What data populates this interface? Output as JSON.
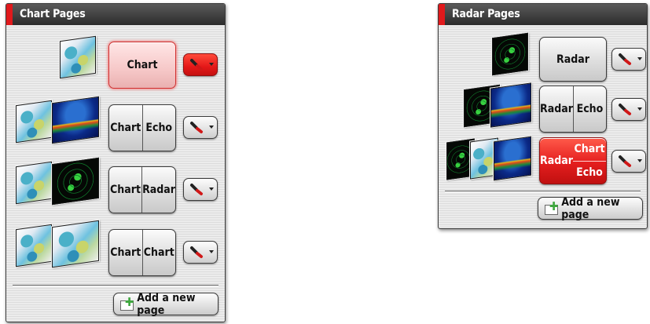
{
  "chart_panel": {
    "title": "Chart Pages",
    "rows": [
      {
        "thumbs": [
          "chart"
        ],
        "segments": [
          "Chart"
        ],
        "state": "selected"
      },
      {
        "thumbs": [
          "chart",
          "echo"
        ],
        "segments": [
          "Chart",
          "Echo"
        ],
        "state": "normal"
      },
      {
        "thumbs": [
          "chart",
          "radar"
        ],
        "segments": [
          "Chart",
          "Radar"
        ],
        "state": "normal"
      },
      {
        "thumbs": [
          "chart",
          "chart"
        ],
        "segments": [
          "Chart",
          "Chart"
        ],
        "state": "normal"
      }
    ],
    "add_label": "Add a new page"
  },
  "radar_panel": {
    "title": "Radar Pages",
    "rows": [
      {
        "thumbs": [
          "radar"
        ],
        "segments": [
          "Radar"
        ],
        "state": "normal"
      },
      {
        "thumbs": [
          "radar",
          "echo"
        ],
        "segments": [
          "Radar",
          "Echo"
        ],
        "state": "normal"
      },
      {
        "thumbs": [
          "radar",
          "chart",
          "echo"
        ],
        "segments": [
          "Radar",
          "Chart",
          "Echo"
        ],
        "state": "active"
      }
    ],
    "add_label": "Add a new page"
  },
  "icons": {
    "settings": "wrench-icon",
    "dropdown": "caret-down-icon",
    "add": "add-page-icon"
  },
  "colors": {
    "accent": "#e0191c",
    "header_dark": "#2c2c2c",
    "active_button": "#e41e1e"
  }
}
